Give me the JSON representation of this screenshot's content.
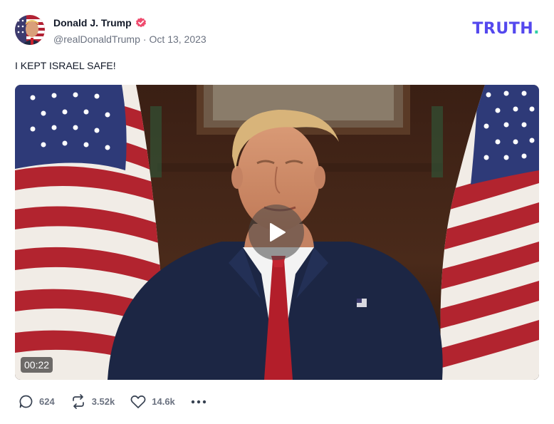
{
  "post": {
    "author_name": "Donald J. Trump",
    "handle": "@realDonaldTrump",
    "separator": "·",
    "date": "Oct 13, 2023",
    "text": "I KEPT ISRAEL SAFE!"
  },
  "brand": {
    "word": "TRUTH",
    "dot": ".",
    "color": "#5448ee",
    "dot_color": "#2fd0a5"
  },
  "video": {
    "duration": "00:22"
  },
  "actions": {
    "replies": "624",
    "retruths": "3.52k",
    "likes": "14.6k"
  },
  "icons": [
    "verified-badge-icon",
    "play-icon",
    "reply-icon",
    "retruth-icon",
    "like-icon",
    "more-icon"
  ]
}
